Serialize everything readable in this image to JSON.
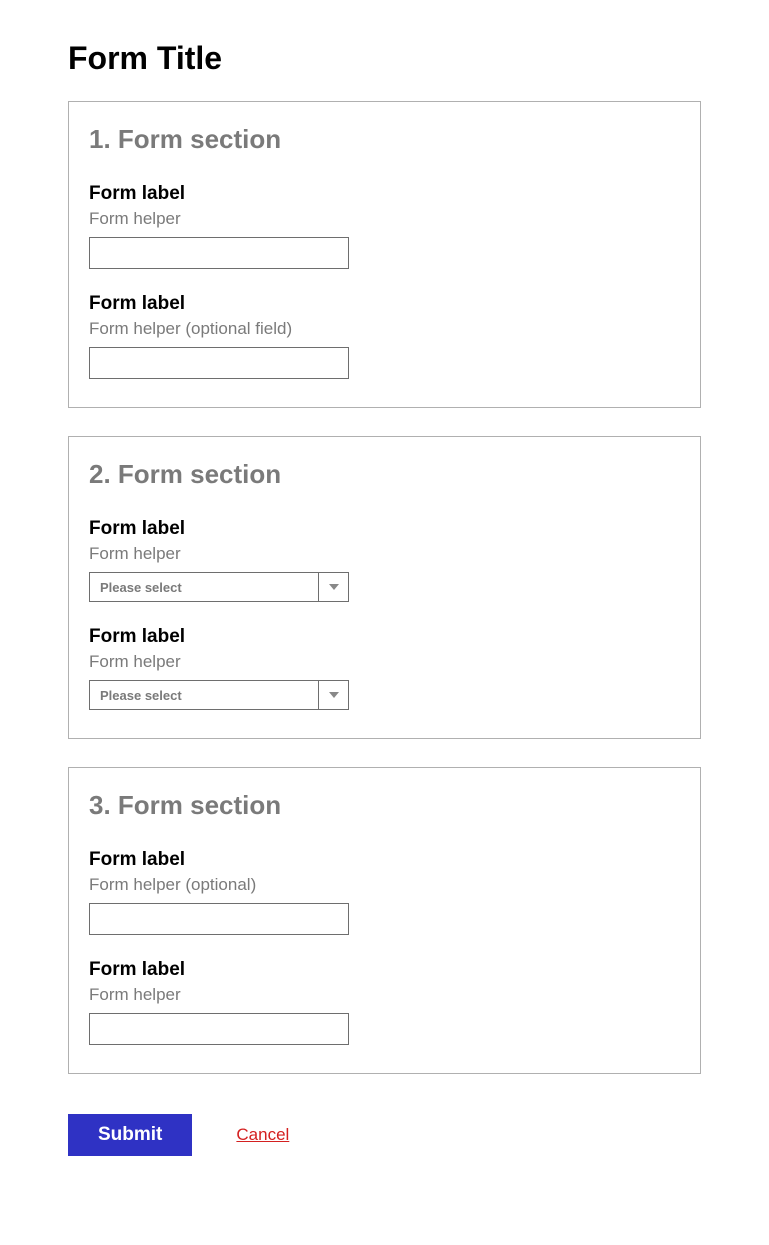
{
  "title": "Form Title",
  "sections": [
    {
      "heading": "1. Form section",
      "fields": [
        {
          "label": "Form label",
          "helper": "Form helper",
          "type": "text",
          "value": ""
        },
        {
          "label": "Form label",
          "helper": "Form helper (optional field)",
          "type": "text",
          "value": ""
        }
      ]
    },
    {
      "heading": "2. Form section",
      "fields": [
        {
          "label": "Form label",
          "helper": "Form helper",
          "type": "select",
          "placeholder": "Please select"
        },
        {
          "label": "Form label",
          "helper": "Form helper",
          "type": "select",
          "placeholder": "Please select"
        }
      ]
    },
    {
      "heading": "3. Form section",
      "fields": [
        {
          "label": "Form label",
          "helper": " Form helper (optional)",
          "type": "text",
          "value": ""
        },
        {
          "label": "Form label",
          "helper": "Form helper",
          "type": "text",
          "value": ""
        }
      ]
    }
  ],
  "actions": {
    "submit": "Submit",
    "cancel": "Cancel"
  }
}
